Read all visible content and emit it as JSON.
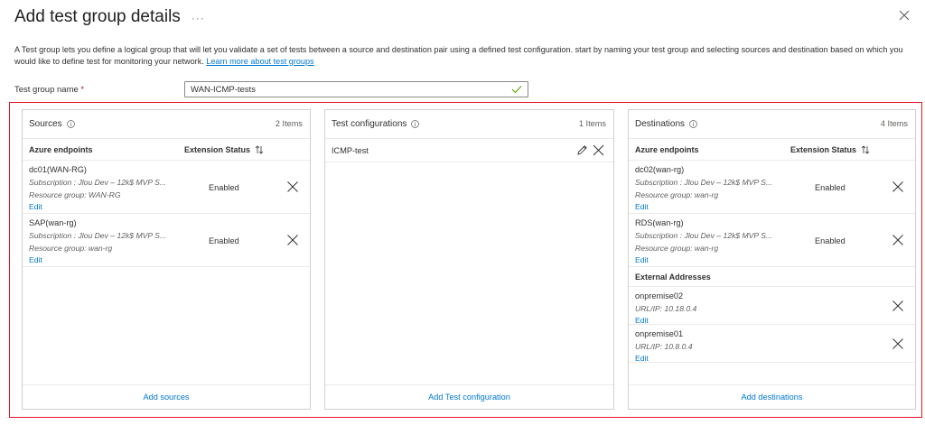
{
  "header": {
    "title": "Add test group details",
    "more": "···"
  },
  "description": {
    "text": "A Test group lets you define a logical group that will let you validate a set of tests between a source and destination pair using a defined test configuration. start by naming your test group and selecting sources and destination based on which you would like to define test for monitoring your network. ",
    "link": "Learn more about test groups"
  },
  "name_field": {
    "label": "Test group name",
    "required_mark": "*",
    "value": "WAN-ICMP-tests"
  },
  "sources": {
    "title": "Sources",
    "count": "2 Items",
    "col_endpoints": "Azure endpoints",
    "col_status": "Extension Status",
    "items": [
      {
        "name": "dc01(WAN-RG)",
        "subscription": "Subscription : Jlou Dev – 12k$ MVP S...",
        "resource_group": "Resource group: WAN-RG",
        "status": "Enabled",
        "edit": "Edit"
      },
      {
        "name": "SAP(wan-rg)",
        "subscription": "Subscription : Jlou Dev – 12k$ MVP S...",
        "resource_group": "Resource group: wan-rg",
        "status": "Enabled",
        "edit": "Edit"
      }
    ],
    "add": "Add sources"
  },
  "configs": {
    "title": "Test configurations",
    "count": "1 Items",
    "items": [
      {
        "name": "ICMP-test"
      }
    ],
    "add": "Add Test configuration"
  },
  "destinations": {
    "title": "Destinations",
    "count": "4 Items",
    "col_endpoints": "Azure endpoints",
    "col_status": "Extension Status",
    "items": [
      {
        "name": "dc02(wan-rg)",
        "subscription": "Subscription : Jlou Dev – 12k$ MVP S...",
        "resource_group": "Resource group: wan-rg",
        "status": "Enabled",
        "edit": "Edit"
      },
      {
        "name": "RDS(wan-rg)",
        "subscription": "Subscription : Jlou Dev – 12k$ MVP S...",
        "resource_group": "Resource group: wan-rg",
        "status": "Enabled",
        "edit": "Edit"
      }
    ],
    "external_title": "External Addresses",
    "external": [
      {
        "name": "onpremise02",
        "url": "URL/IP: 10.18.0.4",
        "edit": "Edit"
      },
      {
        "name": "onpremise01",
        "url": "URL/IP: 10.8.0.4",
        "edit": "Edit"
      }
    ],
    "add": "Add destinations"
  },
  "colors": {
    "accent": "#0078d4",
    "highlight_border": "#e81123",
    "check": "#57a300"
  }
}
